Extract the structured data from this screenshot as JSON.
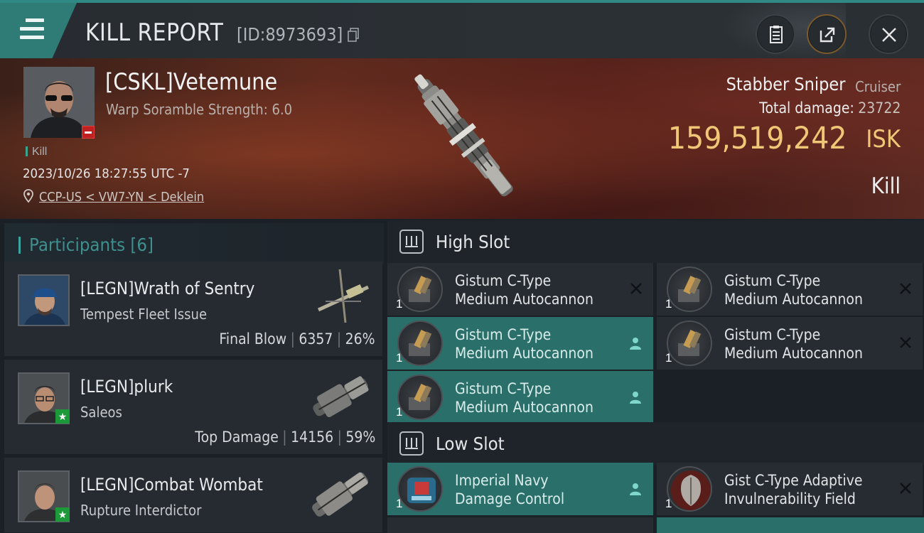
{
  "header": {
    "title": "KILL REPORT",
    "kill_id": "[ID:8973693]"
  },
  "victim": {
    "name": "[CSKL]Vetemune",
    "warp_scramble": "Warp Soramble Strength: 6.0",
    "kill_tag": "Kill",
    "datetime": "2023/10/26 18:27:55 UTC -7",
    "location": "CCP-US < VW7-YN < Deklein",
    "ship_name": "Stabber Sniper",
    "ship_class": "Cruiser",
    "total_damage_label": "Total damage:",
    "total_damage_value": "23722",
    "isk_value": "159,519,242",
    "isk_unit": "ISK",
    "result": "Kill"
  },
  "participants": {
    "header": "Participants [6]",
    "rows": [
      {
        "name": "[LEGN]Wrath of Sentry",
        "ship": "Tempest Fleet Issue",
        "role": "Final Blow",
        "damage": "6357",
        "percent": "26%"
      },
      {
        "name": "[LEGN]plurk",
        "ship": "Saleos",
        "role": "Top Damage",
        "damage": "14156",
        "percent": "59%"
      },
      {
        "name": "[LEGN]Combat Wombat",
        "ship": "Rupture Interdictor"
      }
    ]
  },
  "fitting": {
    "high_slot_label": "High Slot",
    "low_slot_label": "Low Slot",
    "high_modules": [
      {
        "line1": "Gistum C-Type",
        "line2": "Medium Autocannon",
        "qty": "1",
        "state": "destroyed"
      },
      {
        "line1": "Gistum C-Type",
        "line2": "Medium Autocannon",
        "qty": "1",
        "state": "destroyed"
      },
      {
        "line1": "Gistum C-Type",
        "line2": "Medium Autocannon",
        "qty": "1",
        "state": "dropped"
      },
      {
        "line1": "Gistum C-Type",
        "line2": "Medium Autocannon",
        "qty": "1",
        "state": "destroyed"
      },
      {
        "line1": "Gistum C-Type",
        "line2": "Medium Autocannon",
        "qty": "1",
        "state": "dropped"
      }
    ],
    "low_modules": [
      {
        "line1": "Imperial Navy",
        "line2": "Damage Control",
        "qty": "1",
        "state": "dropped"
      },
      {
        "line1": "Gist C-Type Adaptive",
        "line2": "Invulnerability Field",
        "qty": "1",
        "state": "destroyed"
      }
    ]
  },
  "colors": {
    "accent_teal": "#2f7c77",
    "dropped_bg": "#2b6f6b",
    "isk_gold": "#f0c777"
  }
}
